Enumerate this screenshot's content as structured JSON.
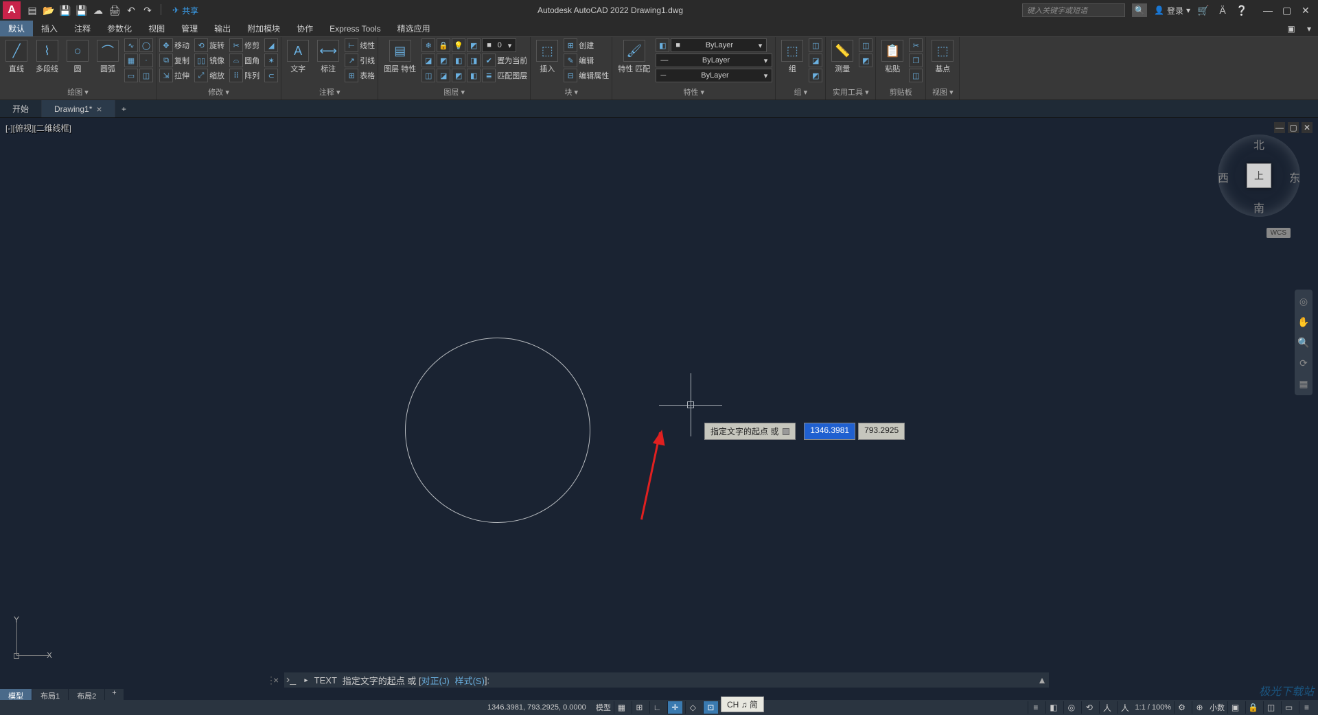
{
  "titlebar": {
    "share": "共享",
    "app_title": "Autodesk AutoCAD 2022    Drawing1.dwg",
    "search_placeholder": "键入关键字或短语",
    "login": "登录"
  },
  "menu": {
    "items": [
      "默认",
      "插入",
      "注释",
      "参数化",
      "视图",
      "管理",
      "输出",
      "附加模块",
      "协作",
      "Express Tools",
      "精选应用"
    ]
  },
  "ribbon": {
    "draw": {
      "line": "直线",
      "polyline": "多段线",
      "circle": "圆",
      "arc": "圆弧",
      "title": "绘图"
    },
    "modify": {
      "move": "移动",
      "rotate": "旋转",
      "trim": "修剪",
      "copy": "复制",
      "mirror": "镜像",
      "fillet": "圆角",
      "stretch": "拉伸",
      "scale": "缩放",
      "array": "阵列",
      "title": "修改"
    },
    "annotation": {
      "text": "文字",
      "dimension": "标注",
      "linear": "线性",
      "leader": "引线",
      "table": "表格",
      "title": "注释"
    },
    "layers": {
      "props": "图层\n特性",
      "setcurrent": "置为当前",
      "match": "匹配图层",
      "value": "0",
      "title": "图层"
    },
    "block": {
      "insert": "插入",
      "create": "创建",
      "edit": "编辑",
      "editattr": "编辑属性",
      "title": "块"
    },
    "properties": {
      "match": "特性\n匹配",
      "layer": "ByLayer",
      "title": "特性"
    },
    "groups": {
      "btn": "组",
      "title": "组"
    },
    "utils": {
      "btn": "测量",
      "title": "实用工具"
    },
    "clipboard": {
      "btn": "粘贴",
      "title": "剪贴板"
    },
    "view": {
      "btn": "基点",
      "title": "视图"
    }
  },
  "tabs": {
    "start": "开始",
    "drawing": "Drawing1*"
  },
  "viewport": {
    "label": "[-][俯视][二维线框]"
  },
  "dynamic": {
    "prompt": "指定文字的起点 或",
    "x": "1346.3981",
    "y": "793.2925"
  },
  "viewcube": {
    "face": "上",
    "n": "北",
    "s": "南",
    "e": "东",
    "w": "西",
    "wcs": "WCS"
  },
  "cmdline": {
    "cmd": "TEXT",
    "text": "指定文字的起点 或 [",
    "opt1": "对正(J)",
    "opt2": "样式(S)",
    "tail": "]:"
  },
  "layout": {
    "model": "模型",
    "l1": "布局1",
    "l2": "布局2"
  },
  "status": {
    "coords": "1346.3981, 793.2925, 0.0000",
    "model": "模型",
    "ime": "CH ♫ 简",
    "decimal": "小数",
    "scale": "1:1 / 100%"
  },
  "watermark": "极光下载站"
}
